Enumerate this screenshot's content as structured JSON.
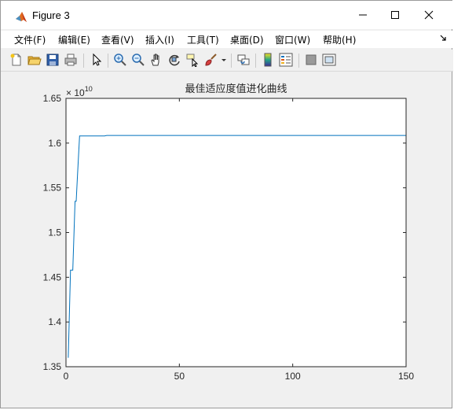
{
  "window": {
    "title": "Figure 3",
    "controls": {
      "minimize": "–",
      "maximize": "☐",
      "close": "✕"
    }
  },
  "menu": {
    "items": [
      {
        "label": "文件(F)"
      },
      {
        "label": "编辑(E)"
      },
      {
        "label": "查看(V)"
      },
      {
        "label": "插入(I)"
      },
      {
        "label": "工具(T)"
      },
      {
        "label": "桌面(D)"
      },
      {
        "label": "窗口(W)"
      },
      {
        "label": "帮助(H)"
      }
    ],
    "overflow_icon": "dock-arrow-icon"
  },
  "toolbar": {
    "icons": [
      "new-figure-icon",
      "open-file-icon",
      "save-icon",
      "print-icon",
      "edit-plot-arrow-icon",
      "zoom-in-icon",
      "zoom-out-icon",
      "pan-hand-icon",
      "rotate-3d-icon",
      "data-cursor-icon",
      "brush-icon",
      "link-plot-icon",
      "colorbar-icon",
      "legend-icon",
      "hide-plot-tools-icon",
      "show-plot-tools-icon"
    ]
  },
  "chart_data": {
    "type": "line",
    "title": "最佳适应度值进化曲线",
    "xlabel": "",
    "ylabel": "",
    "exponent_label": "× 10",
    "exponent_power": "10",
    "xlim": [
      0,
      150
    ],
    "ylim": [
      1.35,
      1.65
    ],
    "xticks": [
      "0",
      "50",
      "100",
      "150"
    ],
    "yticks": [
      "1.35",
      "1.4",
      "1.45",
      "1.5",
      "1.55",
      "1.6",
      "1.65"
    ],
    "grid": false,
    "color": "#0072bd",
    "series": [
      {
        "x": [
          1,
          2,
          2.5,
          3,
          4,
          4.5,
          5,
          6,
          10,
          17,
          18,
          50,
          100,
          150
        ],
        "values": [
          1.36,
          1.458,
          1.458,
          1.458,
          1.535,
          1.535,
          1.56,
          1.608,
          1.608,
          1.608,
          1.6085,
          1.6085,
          1.6085,
          1.6085
        ]
      }
    ]
  }
}
